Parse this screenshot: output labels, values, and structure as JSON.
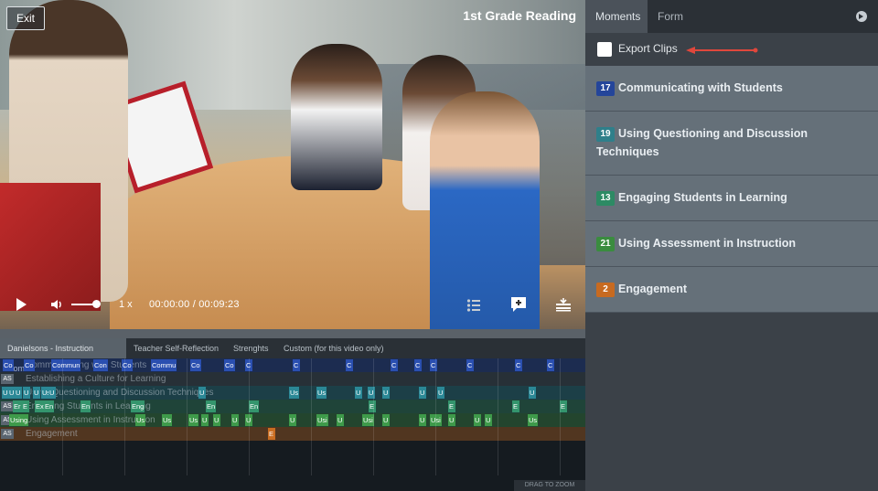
{
  "video": {
    "exit_label": "Exit",
    "title": "1st Grade Reading",
    "speed": "1 x",
    "current_time": "00:00:00",
    "separator": "/",
    "duration": "00:09:23",
    "progress_fraction": 0.0
  },
  "panel": {
    "tabs": [
      "Moments",
      "Form"
    ],
    "active_tab": "Moments",
    "export_label": "Export Clips",
    "moments": [
      {
        "count": "17",
        "label": "Communicating with Students",
        "color": "#24459a"
      },
      {
        "count": "19",
        "label": "Using Questioning and Discussion Techniques",
        "color": "#2f7f8a"
      },
      {
        "count": "13",
        "label": "Engaging Students in Learning",
        "color": "#2d8a64"
      },
      {
        "count": "21",
        "label": "Using Assessment in Instruction",
        "color": "#3a8c3f"
      },
      {
        "count": "2",
        "label": "Engagement",
        "color": "#c76a20"
      }
    ]
  },
  "timeline": {
    "tabs": [
      "Danielsons - Instruction Dom...",
      "Teacher Self-Reflection",
      "Strenghts",
      "Custom (for this video only)"
    ],
    "rows": [
      {
        "label": "Communicating with Students",
        "color": "#2a4fb0",
        "marks": [
          "Co",
          "Co",
          "Commun",
          "Con",
          "Co",
          "Commu",
          "Co",
          "Co",
          "C",
          "C",
          "C",
          "C",
          "C",
          "C",
          "C",
          "C",
          "C"
        ]
      },
      {
        "label": "Establishing a Culture for Learning",
        "color": "#4c5a67",
        "as": "AS",
        "marks": []
      },
      {
        "label": "Using Questioning and Discussion Techniques",
        "color": "#2b8896",
        "marks": [
          "U",
          "U",
          "U",
          "U",
          "U",
          "Us",
          "U",
          "U",
          "Us",
          "Us",
          "U",
          "U",
          "U",
          "U",
          "U",
          "U"
        ]
      },
      {
        "label": "Engaging Students in Learning",
        "color": "#34956d",
        "as": "AS",
        "marks": [
          "Er",
          "E",
          "Ex",
          "En",
          "En",
          "Eng",
          "En",
          "En",
          "E",
          "E",
          "E",
          "E"
        ]
      },
      {
        "label": "Using Assessment in Instruction",
        "color": "#3e9a4a",
        "as": "AS",
        "marks": [
          "Using",
          "Us",
          "Us",
          "Us",
          "U",
          "U",
          "U",
          "U",
          "U",
          "Usi",
          "U",
          "Usi",
          "U",
          "U",
          "Usi",
          "U",
          "U",
          "U",
          "Us"
        ]
      },
      {
        "label": "Engagement",
        "color": "#c96d22",
        "as": "AS",
        "marks": [
          "E"
        ]
      }
    ],
    "zoom_label": "DRAG TO ZOOM"
  }
}
